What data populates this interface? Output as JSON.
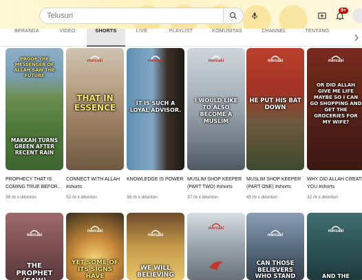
{
  "search": {
    "placeholder": "Telusuri",
    "value": ""
  },
  "notifications": {
    "count": "9+"
  },
  "tabs": [
    {
      "label": "BERANDA"
    },
    {
      "label": "VIDEO"
    },
    {
      "label": "SHORTS"
    },
    {
      "label": "LIVE"
    },
    {
      "label": "PLAYLIST"
    },
    {
      "label": "KOMUNITAS"
    },
    {
      "label": "CHANNEL"
    },
    {
      "label": "TENTANG"
    }
  ],
  "active_tab": "SHORTS",
  "shorts_row1": [
    {
      "overlay_top": "PROOF THE MESSENGER OF ALLAH SAW THE FUTURE",
      "overlay_bottom": "MAKKAH TURNS GREEN AFTER RECENT RAIN",
      "title": "PROPHECY THAT IS COMING TRUE BEFOR...",
      "views": "38 rb x ditonton"
    },
    {
      "overlay": "THAT IN ESSENCE",
      "logo": "mercaki",
      "title": "CONNECT WITH ALLAH #shorts",
      "views": "52 rb x ditonton"
    },
    {
      "overlay": "IT IS SUCH A LOYAL ADVISOR.",
      "logo": "mercaki",
      "title": "KNOWLEDGE IS POWER",
      "views": "38 rb x ditonton"
    },
    {
      "overlay": "I WOULD LIKE TO ALSO BECOME A MUSLIM",
      "logo": "mercaki",
      "title": "MUSLIM SHOP KEEPER (PART TWO) #shorts",
      "views": "37 rb x ditonton"
    },
    {
      "overlay": "HE PUT HIS BAT DOWN",
      "logo": "mercaki",
      "title": "MUSLIM SHOP KEEPER (PART ONE) #shorts",
      "views": "45 rb x ditonton"
    },
    {
      "overlay": "OR DID ALLAH GIVE ME LIFE MAYBE SO I CAN GO SHOPPING AND GET THE GROCERIES FOR MY WIFE?",
      "logo": "mercaki",
      "title": "WHY DID ALLAH CREATE YOU #shorts",
      "views": "32 rb x ditonton"
    }
  ],
  "shorts_row2": [
    {
      "overlay": "THE PROPHET (SAW)",
      "logo": "mercaki"
    },
    {
      "overlay": "YET SOME OF ITS SIGNS HAVE",
      "logo": "mercaki"
    },
    {
      "overlay": "WE WILL BELIEVING",
      "logo": "mercaki"
    },
    {
      "overlay": "",
      "logo": "mercaki"
    },
    {
      "overlay": "CAN THOSE BELIEVERS WHO STAND",
      "logo": "mercaki"
    },
    {
      "overlay": "AND THE",
      "logo": "mercaki"
    }
  ],
  "colors": {
    "accent": "#cc0000",
    "tab_active_bg": "#e7e7e7",
    "text_primary": "#0f0f0f",
    "text_secondary": "#606060"
  },
  "icons": [
    "search-icon",
    "mic-icon",
    "create-icon",
    "bell-icon",
    "chevron-right-icon"
  ]
}
